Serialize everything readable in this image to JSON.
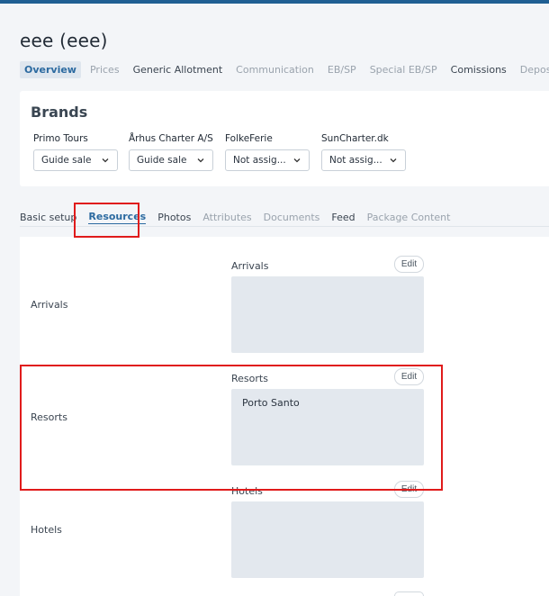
{
  "page": {
    "title": "eee (eee)"
  },
  "top_tabs": [
    {
      "label": "Overview",
      "state": "active"
    },
    {
      "label": "Prices",
      "state": "muted"
    },
    {
      "label": "Generic Allotment",
      "state": "dark"
    },
    {
      "label": "Communication",
      "state": "muted"
    },
    {
      "label": "EB/SP",
      "state": "muted"
    },
    {
      "label": "Special EB/SP",
      "state": "muted"
    },
    {
      "label": "Comissions",
      "state": "dark"
    },
    {
      "label": "Deposit",
      "state": "muted"
    }
  ],
  "brands": {
    "title": "Brands",
    "items": [
      {
        "name": "Primo Tours",
        "value": "Guide sale"
      },
      {
        "name": "Århus Charter A/S",
        "value": "Guide sale"
      },
      {
        "name": "FolkeFerie",
        "value": "Not assig..."
      },
      {
        "name": "SunCharter.dk",
        "value": "Not assig..."
      }
    ]
  },
  "sub_tabs": [
    {
      "label": "Basic setup",
      "state": "dark"
    },
    {
      "label": "Resources",
      "state": "active"
    },
    {
      "label": "Photos",
      "state": "dark"
    },
    {
      "label": "Attributes",
      "state": "muted"
    },
    {
      "label": "Documents",
      "state": "muted"
    },
    {
      "label": "Feed",
      "state": "dark"
    },
    {
      "label": "Package Content",
      "state": "muted"
    }
  ],
  "resources": {
    "edit_label": "Edit",
    "rows": [
      {
        "label": "Arrivals",
        "field_label": "Arrivals",
        "items": []
      },
      {
        "label": "Resorts",
        "field_label": "Resorts",
        "items": [
          "Porto Santo"
        ]
      },
      {
        "label": "Hotels",
        "field_label": "Hotels",
        "items": []
      }
    ]
  },
  "colors": {
    "accent": "#2c6aa0",
    "topbar": "#1f5f93",
    "highlight": "#e01b1b",
    "box_fill": "#e3e8ee"
  }
}
